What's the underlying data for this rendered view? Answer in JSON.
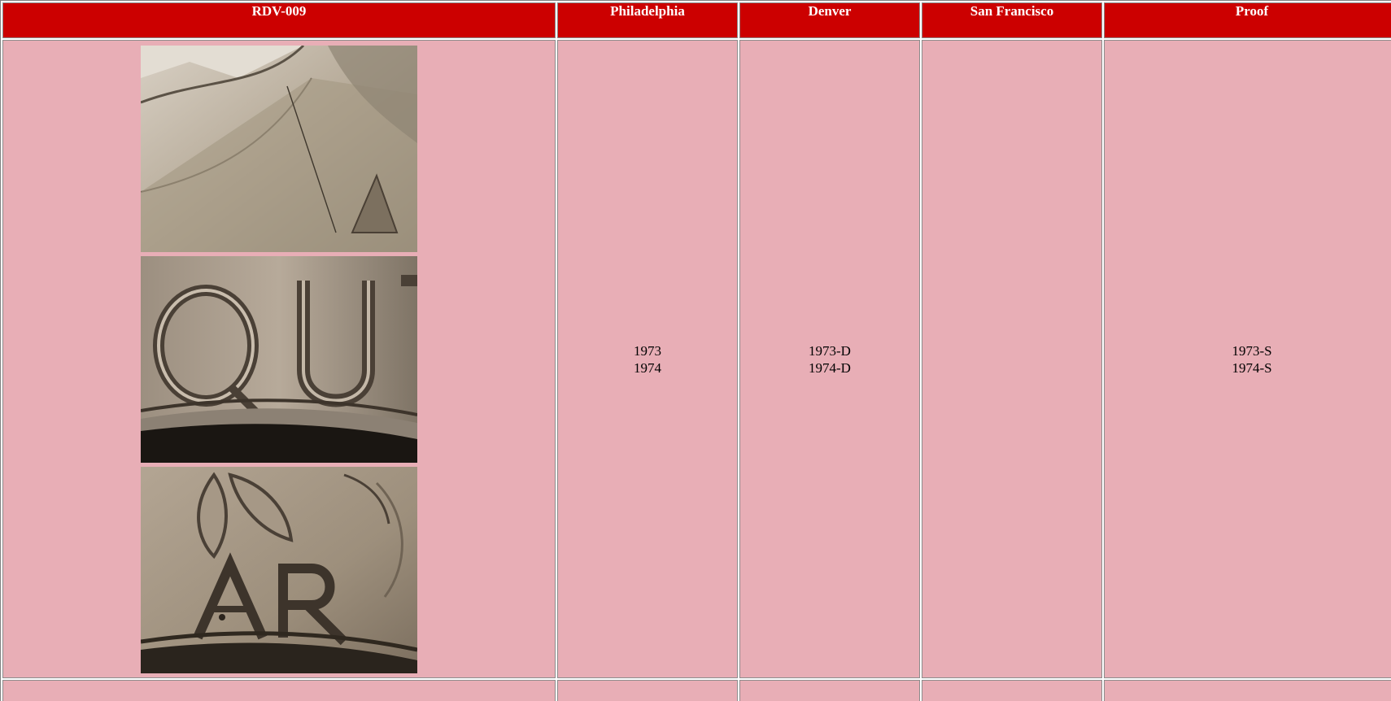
{
  "table": {
    "headers": [
      "RDV-009",
      "Philadelphia",
      "Denver",
      "San Francisco",
      "Proof"
    ],
    "row": {
      "philadelphia": [
        "1973",
        "1974"
      ],
      "denver": [
        "1973-D",
        "1974-D"
      ],
      "san_francisco": [],
      "proof": [
        "1973-S",
        "1974-S"
      ]
    },
    "photos": [
      {
        "name": "close-up-photo-1"
      },
      {
        "name": "close-up-photo-2-quarter-letters-QU"
      },
      {
        "name": "close-up-photo-3-letters-AR"
      }
    ],
    "colors": {
      "header_bg": "#cc0000",
      "cell_bg": "#e8aeb6"
    }
  }
}
